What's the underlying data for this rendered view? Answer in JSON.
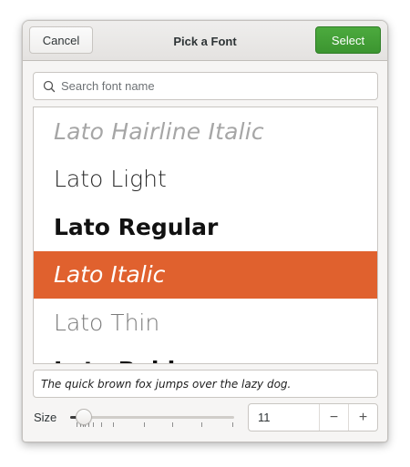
{
  "header": {
    "cancel_label": "Cancel",
    "title": "Pick a Font",
    "select_label": "Select"
  },
  "search": {
    "placeholder": "Search font name",
    "value": ""
  },
  "fonts": [
    {
      "label": "Lato Hairline Italic",
      "selected": false
    },
    {
      "label": "Lato Light",
      "selected": false
    },
    {
      "label": "Lato Regular",
      "selected": false
    },
    {
      "label": "Lato Italic",
      "selected": true
    },
    {
      "label": "Lato Thin",
      "selected": false
    },
    {
      "label": "Lato Bold",
      "selected": false
    }
  ],
  "preview": {
    "text": "The quick brown fox jumps over the lazy dog."
  },
  "size": {
    "label": "Size",
    "value": "11",
    "decrease_label": "−",
    "increase_label": "+",
    "slider_level": 0.05
  },
  "colors": {
    "accent_selected": "#e0612e",
    "select_button": "#3c9530"
  }
}
